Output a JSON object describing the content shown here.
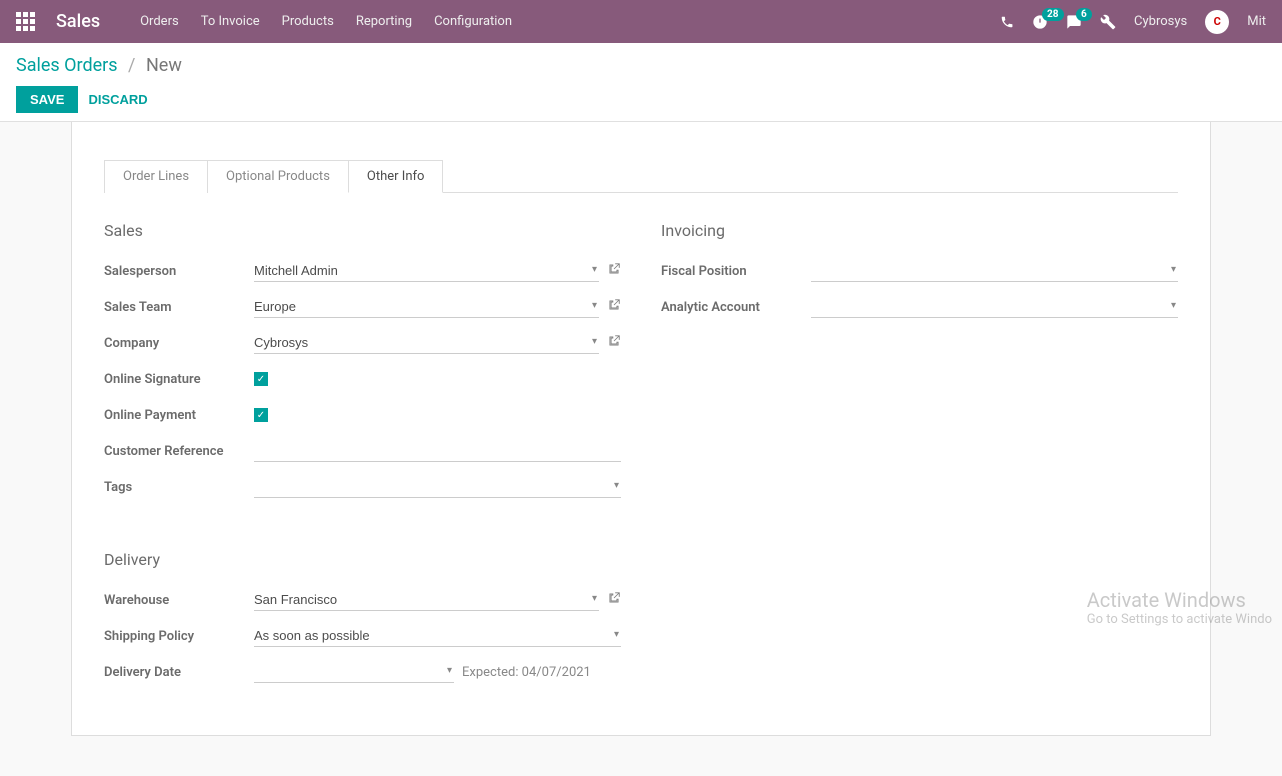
{
  "navbar": {
    "brand": "Sales",
    "menu": [
      "Orders",
      "To Invoice",
      "Products",
      "Reporting",
      "Configuration"
    ],
    "badges": {
      "activities": "28",
      "messages": "6"
    },
    "company": "Cybrosys",
    "user": "Mit"
  },
  "breadcrumb": {
    "root": "Sales Orders",
    "current": "New"
  },
  "buttons": {
    "save": "SAVE",
    "discard": "DISCARD"
  },
  "tabs": [
    "Order Lines",
    "Optional Products",
    "Other Info"
  ],
  "active_tab": "Other Info",
  "sections": {
    "sales": {
      "title": "Sales",
      "fields": {
        "salesperson": {
          "label": "Salesperson",
          "value": "Mitchell Admin"
        },
        "sales_team": {
          "label": "Sales Team",
          "value": "Europe"
        },
        "company": {
          "label": "Company",
          "value": "Cybrosys"
        },
        "online_signature": {
          "label": "Online Signature",
          "checked": true
        },
        "online_payment": {
          "label": "Online Payment",
          "checked": true
        },
        "customer_reference": {
          "label": "Customer Reference",
          "value": ""
        },
        "tags": {
          "label": "Tags",
          "value": ""
        }
      }
    },
    "invoicing": {
      "title": "Invoicing",
      "fields": {
        "fiscal_position": {
          "label": "Fiscal Position",
          "value": ""
        },
        "analytic_account": {
          "label": "Analytic Account",
          "value": ""
        }
      }
    },
    "delivery": {
      "title": "Delivery",
      "fields": {
        "warehouse": {
          "label": "Warehouse",
          "value": "San Francisco"
        },
        "shipping_policy": {
          "label": "Shipping Policy",
          "value": "As soon as possible"
        },
        "delivery_date": {
          "label": "Delivery Date",
          "value": "",
          "expected": "Expected: 04/07/2021"
        }
      }
    }
  },
  "watermark": {
    "line1": "Activate Windows",
    "line2": "Go to Settings to activate Windo"
  }
}
